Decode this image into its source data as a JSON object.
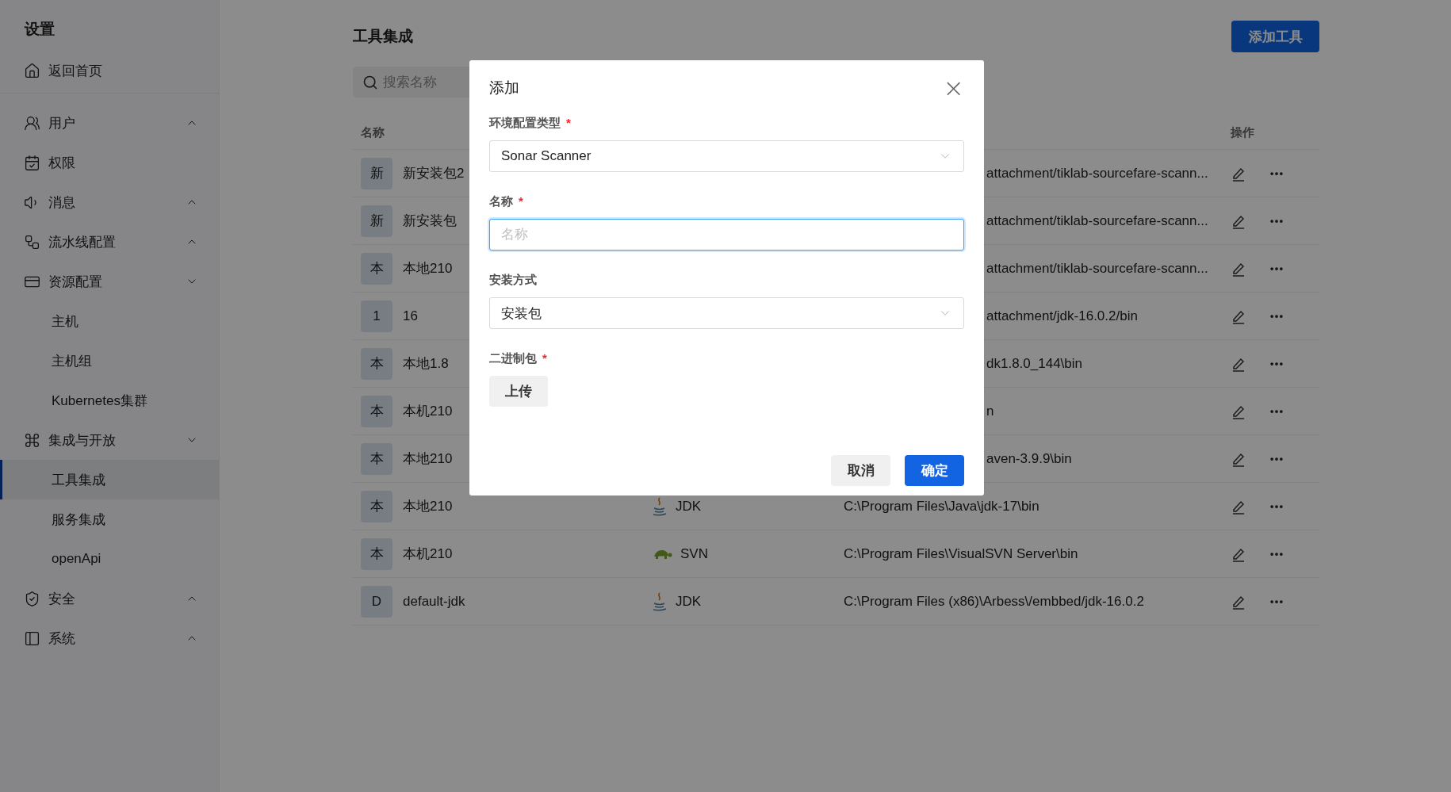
{
  "sidebar": {
    "title": "设置",
    "home": "返回首页",
    "items": [
      {
        "label": "用户",
        "expanded": false
      },
      {
        "label": "权限"
      },
      {
        "label": "消息",
        "expanded": false
      },
      {
        "label": "流水线配置",
        "expanded": false
      },
      {
        "label": "资源配置",
        "expanded": true,
        "children": [
          {
            "label": "主机",
            "selected": false
          },
          {
            "label": "主机组",
            "selected": false
          },
          {
            "label": "Kubernetes集群",
            "selected": false
          }
        ]
      },
      {
        "label": "集成与开放",
        "expanded": true,
        "children": [
          {
            "label": "工具集成",
            "selected": true
          },
          {
            "label": "服务集成",
            "selected": false
          },
          {
            "label": "openApi",
            "selected": false
          }
        ]
      },
      {
        "label": "安全",
        "expanded": false
      },
      {
        "label": "系统",
        "expanded": false
      }
    ]
  },
  "page": {
    "title": "工具集成",
    "add_button": "添加工具",
    "search": {
      "placeholder": "搜索名称"
    }
  },
  "table": {
    "columns": [
      "名称",
      "操作"
    ],
    "rows": [
      {
        "initial": "新",
        "name": "新安装包2",
        "path": "attachment/tiklab-sourcefare-scann..."
      },
      {
        "initial": "新",
        "name": "新安装包",
        "path": "attachment/tiklab-sourcefare-scann..."
      },
      {
        "initial": "本",
        "name": "本地210",
        "path": "attachment/tiklab-sourcefare-scann..."
      },
      {
        "initial": "1",
        "name": "16",
        "path": "attachment/jdk-16.0.2/bin"
      },
      {
        "initial": "本",
        "name": "本地1.8",
        "path": "dk1.8.0_144\\bin"
      },
      {
        "initial": "本",
        "name": "本机210",
        "path": "n"
      },
      {
        "initial": "本",
        "name": "本地210",
        "path": "aven-3.9.9\\bin"
      },
      {
        "initial": "本",
        "name": "本地210",
        "type": {
          "kind": "jdk",
          "label": "JDK"
        },
        "path": "C:\\Program Files\\Java\\jdk-17\\bin"
      },
      {
        "initial": "本",
        "name": "本机210",
        "type": {
          "kind": "svn",
          "label": "SVN"
        },
        "path": "C:\\Program Files\\VisualSVN Server\\bin"
      },
      {
        "initial": "D",
        "name": "default-jdk",
        "type": {
          "kind": "jdk",
          "label": "JDK"
        },
        "path": "C:\\Program Files (x86)\\Arbess\\/embbed/jdk-16.0.2"
      }
    ]
  },
  "dialog": {
    "title": "添加",
    "close": "×",
    "fields": [
      {
        "kind": "select",
        "label": "环境配置类型",
        "required_mark": "*",
        "value": "Sonar Scanner"
      },
      {
        "kind": "input",
        "label": "名称",
        "required_mark": "*",
        "placeholder": "名称",
        "focused": true
      },
      {
        "kind": "select",
        "label": "安装方式",
        "value": "安装包"
      },
      {
        "kind": "upload",
        "label": "二进制包",
        "required_mark": "*",
        "button": "上传"
      }
    ],
    "buttons": [
      {
        "kind": "secondary",
        "label": "取消"
      },
      {
        "kind": "primary",
        "label": "确定"
      }
    ]
  }
}
